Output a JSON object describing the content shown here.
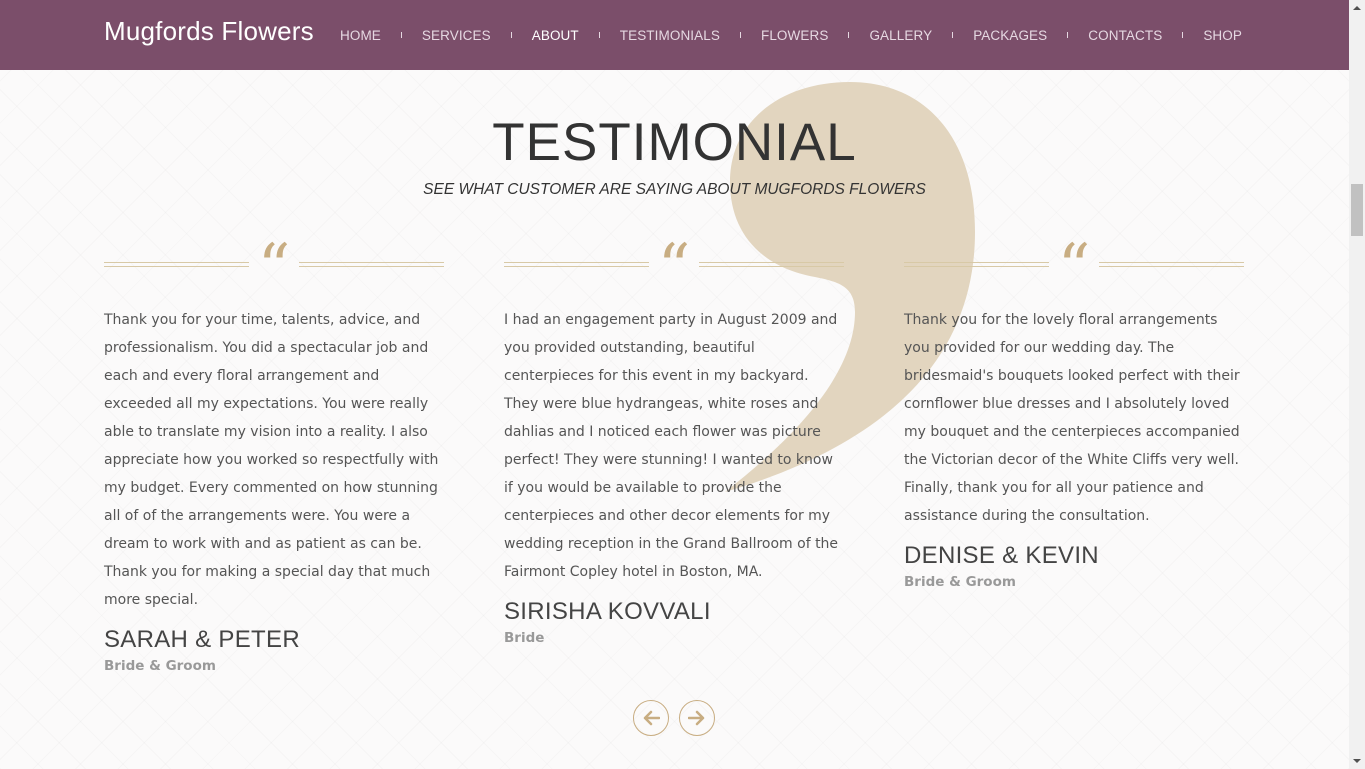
{
  "header": {
    "brand": "Mugfords Flowers",
    "nav": [
      {
        "label": "HOME",
        "active": false
      },
      {
        "label": "SERVICES",
        "active": false
      },
      {
        "label": "ABOUT",
        "active": true
      },
      {
        "label": "TESTIMONIALS",
        "active": false
      },
      {
        "label": "FLOWERS",
        "active": false
      },
      {
        "label": "GALLERY",
        "active": false
      },
      {
        "label": "PACKAGES",
        "active": false
      },
      {
        "label": "CONTACTS",
        "active": false
      },
      {
        "label": "SHOP",
        "active": false
      }
    ]
  },
  "section": {
    "title": "TESTIMONIAL",
    "subtitle": "SEE WHAT CUSTOMER ARE SAYING ABOUT MUGFORDS FLOWERS"
  },
  "testimonials": [
    {
      "quote_glyph": "“",
      "text": "Thank you for your time, talents, advice, and professionalism. You did a spectacular job and each and every floral arrangement and exceeded all my expectations. You were really able to translate my vision into a reality. I also appreciate how you worked so respectfully with my budget. Every commented on how stunning all of of the arrangements were. You were a dream to work with and as patient as can be. Thank you for making a special day that much more special.",
      "name": "SARAH & PETER",
      "role": "Bride & Groom"
    },
    {
      "quote_glyph": "“",
      "text": "I had an engagement party in August 2009 and you provided outstanding, beautiful centerpieces for this event in my backyard. They were blue hydrangeas, white roses and dahlias and I noticed each flower was picture perfect! They were stunning! I wanted to know if you would be available to provide the centerpieces and other decor elements for my wedding reception in the Grand Ballroom of the Fairmont Copley hotel in Boston, MA.",
      "name": "SIRISHA KOVVALI",
      "role": "Bride"
    },
    {
      "quote_glyph": "“",
      "text": "Thank you for the lovely floral arrangements you provided for our wedding day. The bridesmaid's bouquets looked perfect with their cornflower blue dresses and I absolutely loved my bouquet and the centerpieces accompanied the Victorian decor of the White Cliffs very well. Finally, thank you for all your patience and assistance during the consultation.",
      "name": "DENISE & KEVIN",
      "role": "Bride & Groom"
    }
  ],
  "carousel": {
    "prev_icon": "arrow-left-icon",
    "next_icon": "arrow-right-icon"
  },
  "colors": {
    "header_bg": "#7b4e6a",
    "accent_gold": "#c8ad82",
    "decor_tan": "#e2d5bf",
    "text": "#555555"
  }
}
